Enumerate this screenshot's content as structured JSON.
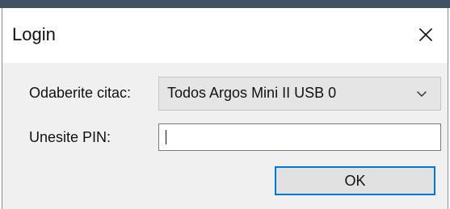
{
  "window": {
    "title": "Login",
    "close_icon": "close-icon"
  },
  "form": {
    "reader_label": "Odaberite citac:",
    "reader_selected": "Todos Argos Mini II USB 0",
    "reader_dropdown_icon": "chevron-down-icon",
    "pin_label": "Unesite PIN:",
    "pin_value": "",
    "ok_label": "OK"
  },
  "colors": {
    "accent": "#0078d7",
    "dialog_background": "#f0f0f0",
    "titlebar_background": "#ffffff",
    "button_background": "#e1e1e1"
  }
}
